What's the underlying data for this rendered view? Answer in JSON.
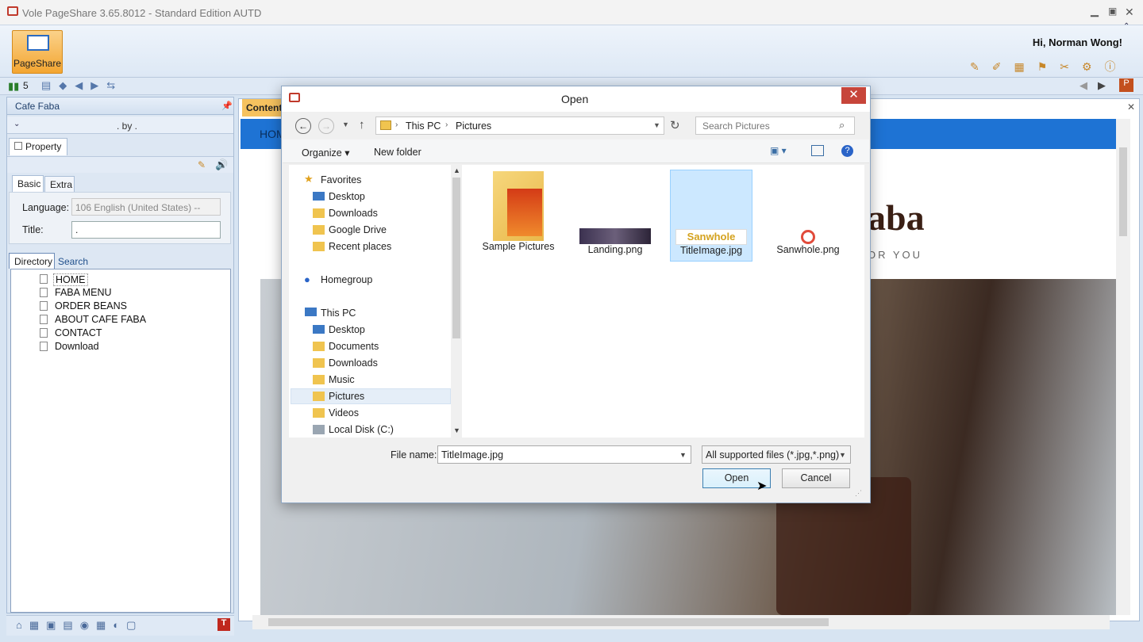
{
  "app": {
    "title": "Vole PageShare  3.65.8012 - Standard Edition AUTD",
    "greeting": "Hi, Norman Wong!",
    "ribbon_button": "PageShare",
    "toolbar_count": "5"
  },
  "panel": {
    "title": "Cafe Faba",
    "subtitle": ". by .",
    "property_tab": "Property",
    "tabs": [
      "Basic",
      "Extra"
    ],
    "language_label": "Language:",
    "language_value": "106 English (United States) --",
    "title_label": "Title:",
    "title_value": ".",
    "lower_tabs": [
      "Directory",
      "Search"
    ],
    "tree": [
      "HOME",
      "FABA MENU",
      "ORDER BEANS",
      "ABOUT CAFE FABA",
      "CONTACT",
      "Download"
    ]
  },
  "content": {
    "tab": "Content",
    "nav_text": "HOM",
    "logo_text": "aba",
    "tagline": "OR YOU"
  },
  "dialog": {
    "title": "Open",
    "breadcrumb": [
      "This PC",
      "Pictures"
    ],
    "search_placeholder": "Search Pictures",
    "organize": "Organize",
    "new_folder": "New folder",
    "nav": {
      "favorites": "Favorites",
      "fav_items": [
        "Desktop",
        "Downloads",
        "Google Drive",
        "Recent places"
      ],
      "homegroup": "Homegroup",
      "thispc": "This PC",
      "pc_items": [
        "Desktop",
        "Documents",
        "Downloads",
        "Music",
        "Pictures",
        "Videos",
        "Local Disk (C:)"
      ]
    },
    "files": [
      "Sample Pictures",
      "Landing.png",
      "TitleImage.jpg",
      "Sanwhole.png"
    ],
    "file_name_label": "File name:",
    "file_name_value": "TitleImage.jpg",
    "filter": "All supported files (*.jpg,*.png)",
    "open_button": "Open",
    "cancel_button": "Cancel",
    "sanwhole_logo": "Sanwhole"
  },
  "colors": {
    "accent": "#1e73d4",
    "selection": "#cce8ff",
    "close": "#c7453a"
  }
}
